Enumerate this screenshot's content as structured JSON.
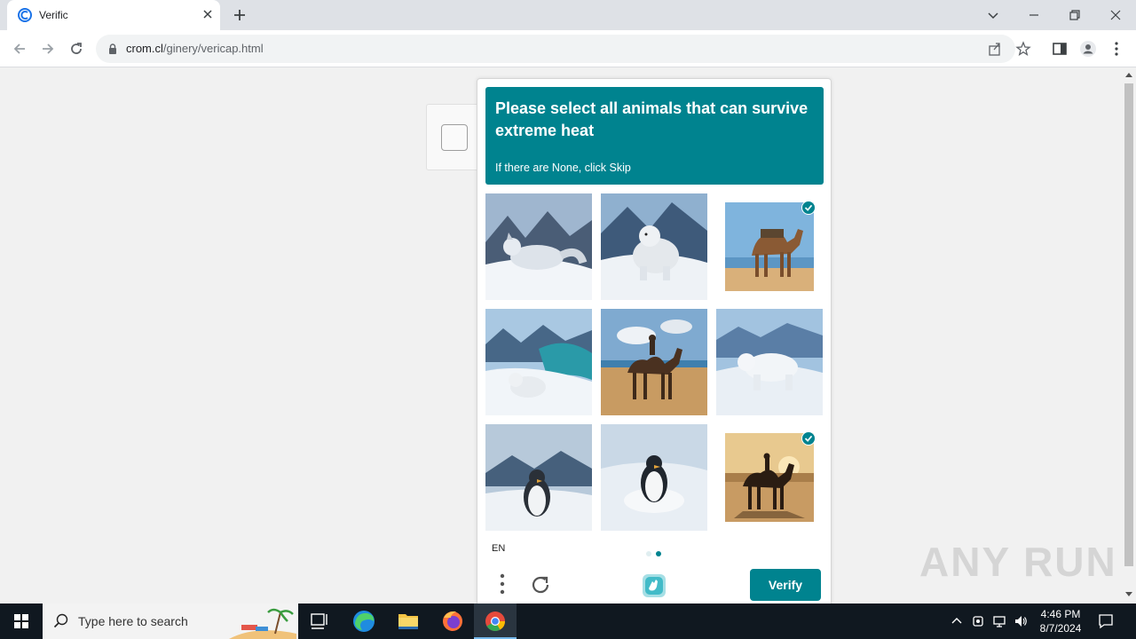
{
  "browser": {
    "tab_title": "Verific",
    "url_host": "crom.cl",
    "url_path": "/ginery/vericap.html"
  },
  "captcha": {
    "prompt_title": "Please select all animals that can survive extreme heat",
    "prompt_subtitle": "If there are None, click Skip",
    "language": "EN",
    "verify_label": "Verify",
    "accent_color": "#00838f",
    "page_index": 2,
    "page_count": 2,
    "tiles": [
      {
        "subject": "arctic-fox",
        "selected": false
      },
      {
        "subject": "polar-bear-cub",
        "selected": false
      },
      {
        "subject": "camel-with-saddle",
        "selected": true
      },
      {
        "subject": "polar-bear-on-ice",
        "selected": false
      },
      {
        "subject": "camel-with-rider",
        "selected": false
      },
      {
        "subject": "polar-bear-walking",
        "selected": false
      },
      {
        "subject": "penguin-on-ice",
        "selected": false
      },
      {
        "subject": "penguin-in-snow",
        "selected": false
      },
      {
        "subject": "camel-sunset",
        "selected": true
      }
    ]
  },
  "watermark": "ANY RUN",
  "taskbar": {
    "search_placeholder": "Type here to search",
    "time": "4:46 PM",
    "date": "8/7/2024"
  }
}
